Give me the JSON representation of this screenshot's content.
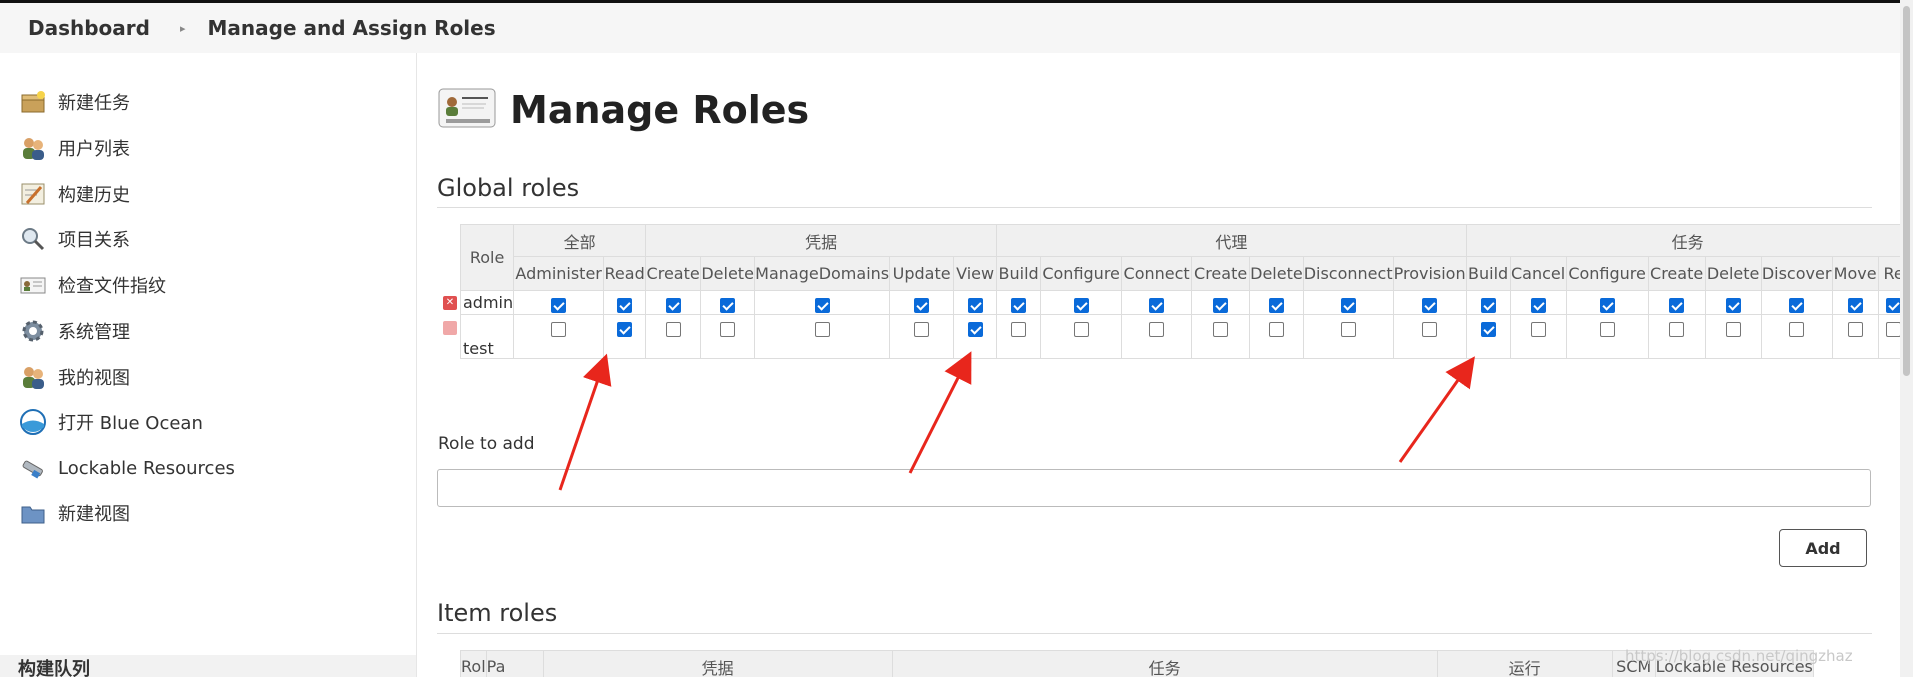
{
  "breadcrumb": {
    "home": "Dashboard",
    "current": "Manage and Assign Roles"
  },
  "sidebar": {
    "items": [
      {
        "label": "新建任务",
        "icon": "new-item-icon"
      },
      {
        "label": "用户列表",
        "icon": "users-icon"
      },
      {
        "label": "构建历史",
        "icon": "build-history-icon"
      },
      {
        "label": "项目关系",
        "icon": "search-icon"
      },
      {
        "label": "检查文件指纹",
        "icon": "fingerprint-icon"
      },
      {
        "label": "系统管理",
        "icon": "gear-icon"
      },
      {
        "label": "我的视图",
        "icon": "my-views-icon"
      },
      {
        "label": "打开 Blue Ocean",
        "icon": "blue-ocean-icon"
      },
      {
        "label": "Lockable Resources",
        "icon": "lock-resources-icon"
      },
      {
        "label": "新建视图",
        "icon": "folder-icon"
      }
    ],
    "footer": "构建队列"
  },
  "page": {
    "title": "Manage Roles"
  },
  "global_roles": {
    "heading": "Global roles",
    "role_header": "Role",
    "groups": [
      {
        "name": "全部",
        "perms": [
          "Administer",
          "Read"
        ]
      },
      {
        "name": "凭据",
        "perms": [
          "Create",
          "Delete",
          "ManageDomains",
          "Update",
          "View"
        ]
      },
      {
        "name": "代理",
        "perms": [
          "Build",
          "Configure",
          "Connect",
          "Create",
          "Delete",
          "Disconnect",
          "Provision"
        ]
      },
      {
        "name": "任务",
        "perms": [
          "Build",
          "Cancel",
          "Configure",
          "Create",
          "Delete",
          "Discover",
          "Move",
          "Re"
        ]
      }
    ],
    "rows": [
      {
        "name": "admin",
        "checks": [
          true,
          true,
          true,
          true,
          true,
          true,
          true,
          true,
          true,
          true,
          true,
          true,
          true,
          true,
          true,
          true,
          true,
          true,
          true,
          true,
          true,
          true
        ]
      },
      {
        "name": "test",
        "checks": [
          false,
          true,
          false,
          false,
          false,
          false,
          true,
          false,
          false,
          false,
          false,
          false,
          false,
          false,
          true,
          false,
          false,
          false,
          false,
          false,
          false,
          false
        ]
      }
    ]
  },
  "add_role": {
    "label": "Role to add",
    "value": "",
    "button": "Add"
  },
  "item_roles": {
    "heading": "Item roles",
    "header_fragments": {
      "role": "Rol",
      "pattern": "Pa"
    },
    "groups": [
      "凭据",
      "任务",
      "运行",
      "SCM",
      "Lockable Resources"
    ]
  },
  "watermark": "https://blog.csdn.net/qingzhaz"
}
